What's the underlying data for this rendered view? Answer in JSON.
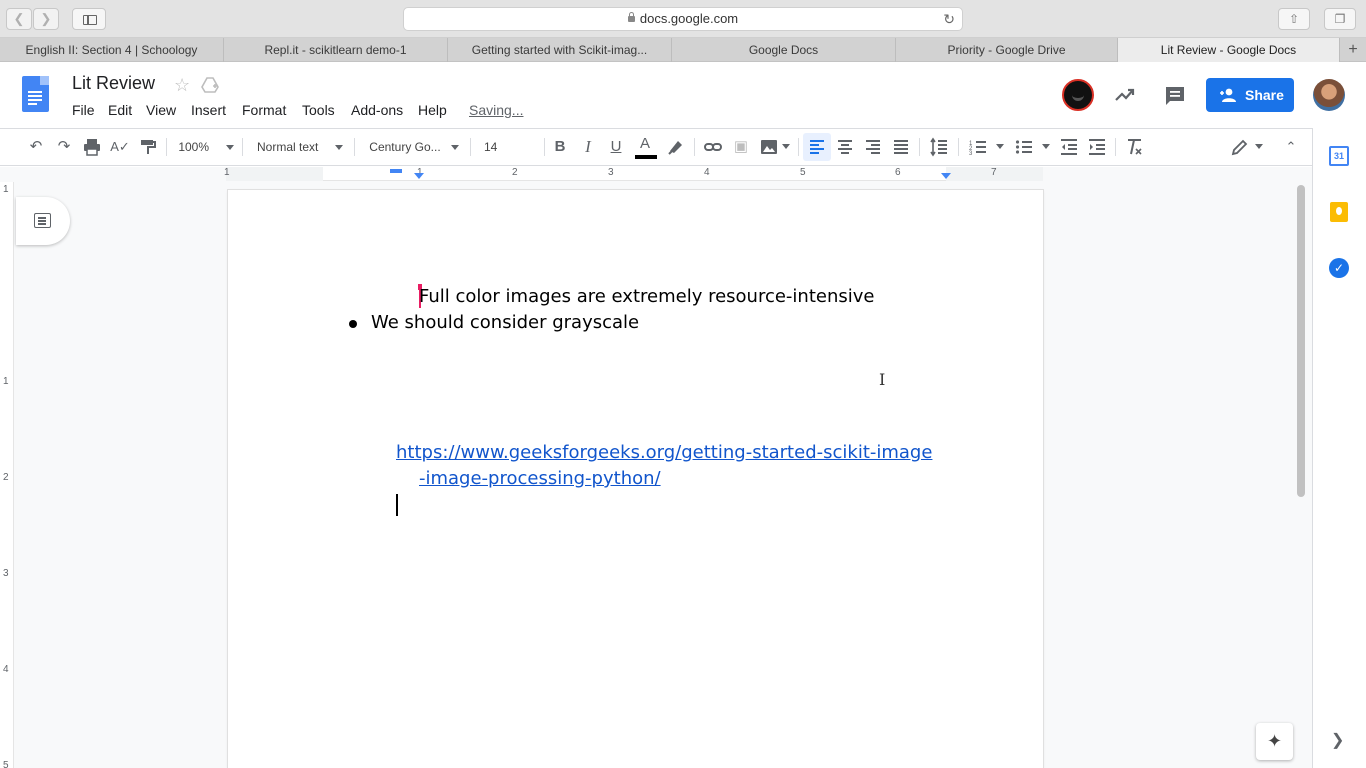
{
  "browser": {
    "url": "docs.google.com",
    "tabs": [
      {
        "label": "English II: Section 4 | Schoology"
      },
      {
        "label": "Repl.it - scikitlearn demo-1"
      },
      {
        "label": "Getting started with Scikit-imag..."
      },
      {
        "label": "Google Docs"
      },
      {
        "label": "Priority - Google Drive"
      },
      {
        "label": "Lit Review - Google Docs",
        "active": true
      }
    ],
    "new_tab": "+"
  },
  "docs": {
    "title": "Lit Review",
    "menu": [
      "File",
      "Edit",
      "View",
      "Insert",
      "Format",
      "Tools",
      "Add-ons",
      "Help"
    ],
    "saving_status": "Saving...",
    "share_label": "Share"
  },
  "toolbar": {
    "zoom": "100%",
    "style": "Normal text",
    "font": "Century Go...",
    "font_size": "14"
  },
  "ruler": {
    "labels": [
      "1",
      "1",
      "2",
      "3",
      "4",
      "5",
      "6",
      "7"
    ],
    "v_labels": [
      "1",
      "1",
      "2",
      "3",
      "4",
      "5"
    ]
  },
  "document": {
    "line1": "Full color images are extremely resource-intensive",
    "bullet1": "We should consider grayscale",
    "link_part1": "https://www.geeksforgeeks.org/getting-started-scikit-image",
    "link_part2": "-image-processing-python/"
  },
  "side_panel": {
    "calendar_label": "31"
  },
  "colors": {
    "accent": "#1a73e8",
    "link": "#1155cc",
    "collaborator_cursor": "#e91e63"
  }
}
